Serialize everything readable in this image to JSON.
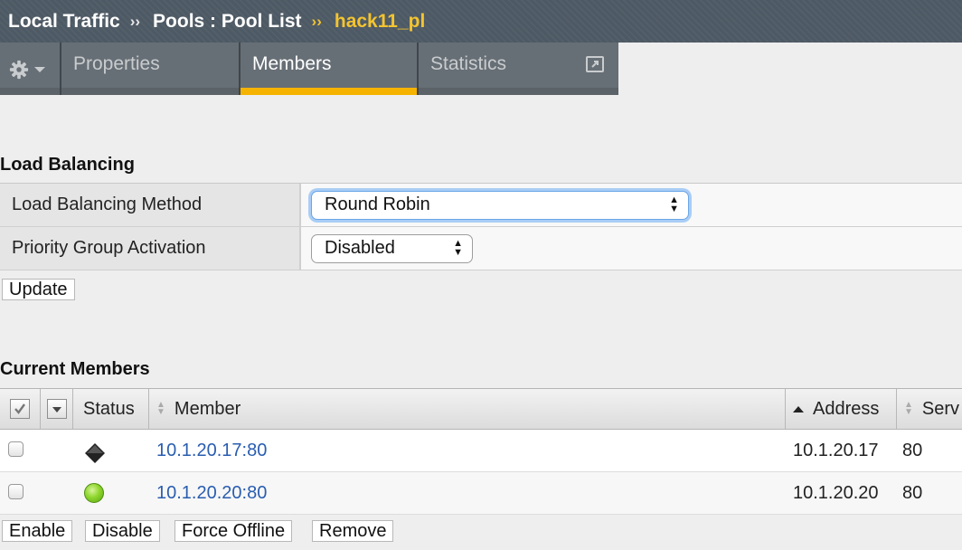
{
  "breadcrumb": {
    "items": [
      "Local Traffic",
      "Pools : Pool List"
    ],
    "separator": "››",
    "current": "hack11_pl"
  },
  "tabs": [
    {
      "label": "Properties"
    },
    {
      "label": "Members"
    },
    {
      "label": "Statistics"
    }
  ],
  "active_tab": "Members",
  "load_balancing": {
    "title": "Load Balancing",
    "method_label": "Load Balancing Method",
    "method_value": "Round Robin",
    "priority_label": "Priority Group Activation",
    "priority_value": "Disabled",
    "update_button": "Update"
  },
  "members": {
    "title": "Current Members",
    "columns": {
      "status": "Status",
      "member": "Member",
      "address": "Address",
      "service": "Serv"
    },
    "rows": [
      {
        "status": "offline",
        "member": "10.1.20.17:80",
        "address": "10.1.20.17",
        "service": "80"
      },
      {
        "status": "available",
        "member": "10.1.20.20:80",
        "address": "10.1.20.20",
        "service": "80"
      }
    ],
    "buttons": {
      "enable": "Enable",
      "disable": "Disable",
      "force_offline": "Force Offline",
      "remove": "Remove"
    }
  },
  "colors": {
    "accent": "#f5b300",
    "breadcrumb_current": "#f4c430",
    "link": "#2a5db0",
    "status_available": "#8fd62e"
  },
  "icons": {
    "settings": "gear-icon",
    "popout": "popout-icon",
    "status_offline": "black-diamond-icon",
    "status_available": "green-circle-icon"
  }
}
